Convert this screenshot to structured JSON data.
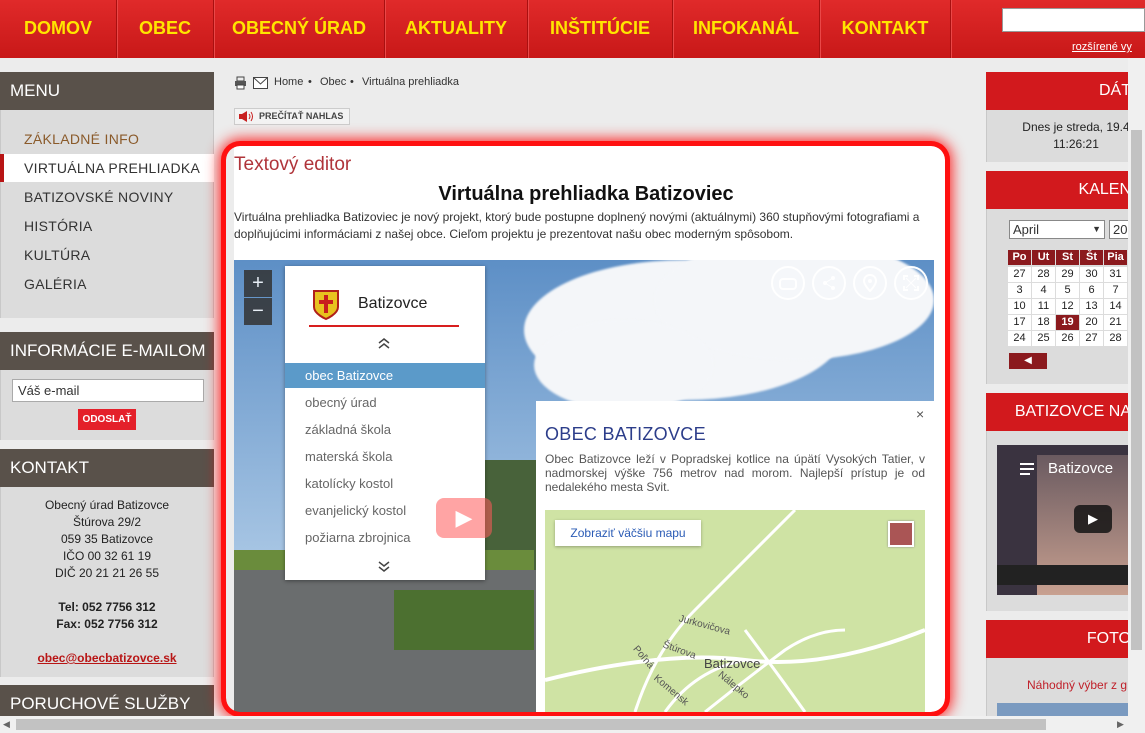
{
  "nav": {
    "items": [
      "DOMOV",
      "OBEC",
      "OBECNÝ ÚRAD",
      "AKTUALITY",
      "INŠTITÚCIE",
      "INFOKANÁL",
      "KONTAKT"
    ],
    "advanced_search": "rozšírené vy"
  },
  "sidebar": {
    "menu_title": "MENU",
    "menu_items": [
      "ZÁKLADNÉ INFO",
      "VIRTUÁLNA PREHLIADKA",
      "BATIZOVSKÉ NOVINY",
      "HISTÓRIA",
      "KULTÚRA",
      "GALÉRIA"
    ],
    "email_title": "INFORMÁCIE E-MAILOM",
    "email_placeholder": "Váš e-mail",
    "send_label": "ODOSLAŤ",
    "contact_title": "KONTAKT",
    "contact_lines": [
      "Obecný úrad Batizovce",
      "Štúrova 29/2",
      "059 35 Batizovce",
      "IČO 00 32 61 19",
      "DIČ 20 21 21 26 55"
    ],
    "tel": "Tel: 052 7756 312",
    "fax": "Fax: 052 7756 312",
    "email": "obec@obecbatizovce.sk",
    "outage_title": "PORUCHOVÉ SLUŽBY"
  },
  "breadcrumb": {
    "items": [
      "Home",
      "•",
      "Obec",
      "•",
      "Virtuálna prehliadka"
    ],
    "read_aloud": "PREČÍTAŤ NAHLAS"
  },
  "content": {
    "editor_label": "Textový editor",
    "title": "Virtuálna prehliadka Batizoviec",
    "intro": "Virtuálna prehliadka Batizoviec je nový projekt, ktorý bude postupne doplnený novými (aktuálnymi) 360 stupňovými fotografiami a doplňujúcimi informáciami z našej obce. Cieľom projektu je prezentovat našu obec moderným spôsobom.",
    "tour": {
      "zoom_in": "+",
      "zoom_out": "−",
      "menu_title": "Batizovce",
      "menu_items": [
        "obec Batizovce",
        "obecný úrad",
        "základná škola",
        "materská škola",
        "katolícky kostol",
        "evanjelický kostol",
        "požiarna zbrojnica"
      ],
      "info_title": "OBEC BATIZOVCE",
      "info_text": "Obec Batizovce leží v Popradskej kotlice na úpätí Vysokých Tatier, v nadmorskej výške 756 metrov nad morom. Najlepší prístup je od nedalekého mesta Svit.",
      "map_button": "Zobraziť väčšiu mapu",
      "map_labels": [
        "Jurkovičova",
        "Štúrova",
        "Poľná",
        "Batizovce",
        "Komensk",
        "Nálepko"
      ],
      "close": "×"
    }
  },
  "right": {
    "date_title": "DÁT",
    "date_text": "Dnes je streda, 19.4",
    "time_text": "11:26:21",
    "calendar_title": "KALEN",
    "month": "April",
    "year": "20",
    "weekdays": [
      "Po",
      "Ut",
      "St",
      "Št",
      "Pia"
    ],
    "weeks": [
      [
        "27",
        "28",
        "29",
        "30",
        "31"
      ],
      [
        "3",
        "4",
        "5",
        "6",
        "7"
      ],
      [
        "10",
        "11",
        "12",
        "13",
        "14"
      ],
      [
        "17",
        "18",
        "19",
        "20",
        "21"
      ],
      [
        "24",
        "25",
        "26",
        "27",
        "28"
      ]
    ],
    "prev": "◀",
    "video_section": "BATIZOVCE NA",
    "video_title": "Batizovce",
    "photo_section": "FOTO",
    "random_text": "Náhodný výber z g"
  }
}
